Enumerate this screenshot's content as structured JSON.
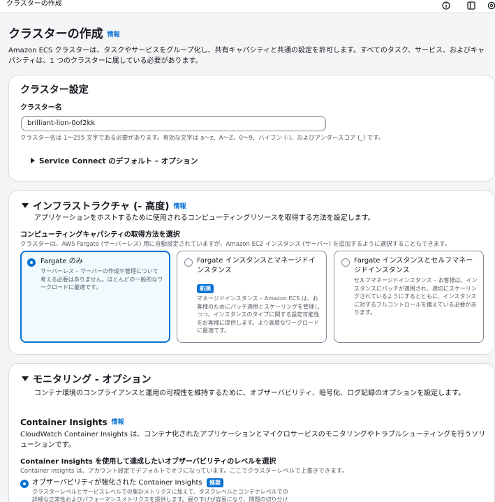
{
  "topbar": {
    "title": "クラスターの作成",
    "icons": [
      "info-circle-icon",
      "panel-toggle-icon",
      "settings-icon"
    ]
  },
  "page": {
    "title": "クラスターの作成",
    "info": "情報",
    "description": "Amazon ECS クラスターは、タスクやサービスをグループ化し、共有キャパシティと共通の設定を許可します。すべてのタスク、サービス、およびキャパシティは、1 つのクラスターに属している必要があります。"
  },
  "cluster_settings": {
    "heading": "クラスター設定",
    "name_label": "クラスター名",
    "name_value": "brilliant-lion-0of2kk",
    "name_hint": "クラスター名は 1～255 文字である必要があります。有効な文字は a～z、A～Z、0～9、ハイフン (-)、およびアンダースコア (_) です。",
    "service_connect": "Service Connect のデフォルト – オプション"
  },
  "infrastructure": {
    "heading": "インフラストラクチャ (- 高度)",
    "info": "情報",
    "description": "アプリケーションをホストするために使用されるコンピューティングリソースを取得する方法を設定します。",
    "capacity_label": "コンピューティングキャパシティの取得方法を選択",
    "capacity_hint": "クラスターは、AWS Fargate (サーバーレス) 用に自動設定されていますが、Amazon EC2 インスタンス (サーバー) を追加するように選択することもできます。",
    "options": [
      {
        "title": "Fargate のみ",
        "description": "サーバーレス – サーバーの作成や管理について考える必要はありません。ほとんどの一般的なワークロードに最適です。",
        "selected": true
      },
      {
        "title": "Fargate インスタンスとマネージドインスタンス",
        "badge": "新規",
        "description": "マネージドインスタンス – Amazon ECS は、お客様のためにパッチ適用とスケーリングを管理しつつ、インスタンスのタイプに関する設定可能性をお客様に提供します。より高度なワークロードに最適です。",
        "selected": false
      },
      {
        "title": "Fargate インスタンスとセルフマネージドインスタンス",
        "description": "セルフマネージドインスタンス – お客様は、インスタンスにパッチが適用され、適切にスケーリングされているようにするとともに、インスタンスに対するフルコントロールを備えている必要があります。",
        "selected": false
      }
    ]
  },
  "monitoring": {
    "heading": "モニタリング - オプション",
    "description": "コンテナ環境のコンプライアンスと運用の可視性を維持するために、オブザーバビリティ、暗号化、ログ記録のオプションを設定します。",
    "ci_heading": "Container Insights",
    "ci_info": "情報",
    "ci_description": "CloudWatch Container Insights は、コンテナ化されたアプリケーションとマイクロサービスのモニタリングやトラブルシューティングを行うソリューションです。",
    "level_label": "Container Insights を使用して達成したいオブザーバビリティのレベルを選択",
    "level_hint": "Container Insights は、アカウント設定でデフォルトでオフになっています。ここでクラスターレベルで上書きできます。",
    "option_title": "オブザーバビリティが強化された Container Insights",
    "option_badge": "推奨",
    "option_desc_line1": "クラスターレベルとサービスレベルでの集計メトリクスに加えて、タスクレベルとコンテナレベルでの",
    "option_desc_line2": "詳細な正常性およびパフォーマンスメトリクスを提供します。掘り下げが容易になり、問題の切り分け"
  }
}
